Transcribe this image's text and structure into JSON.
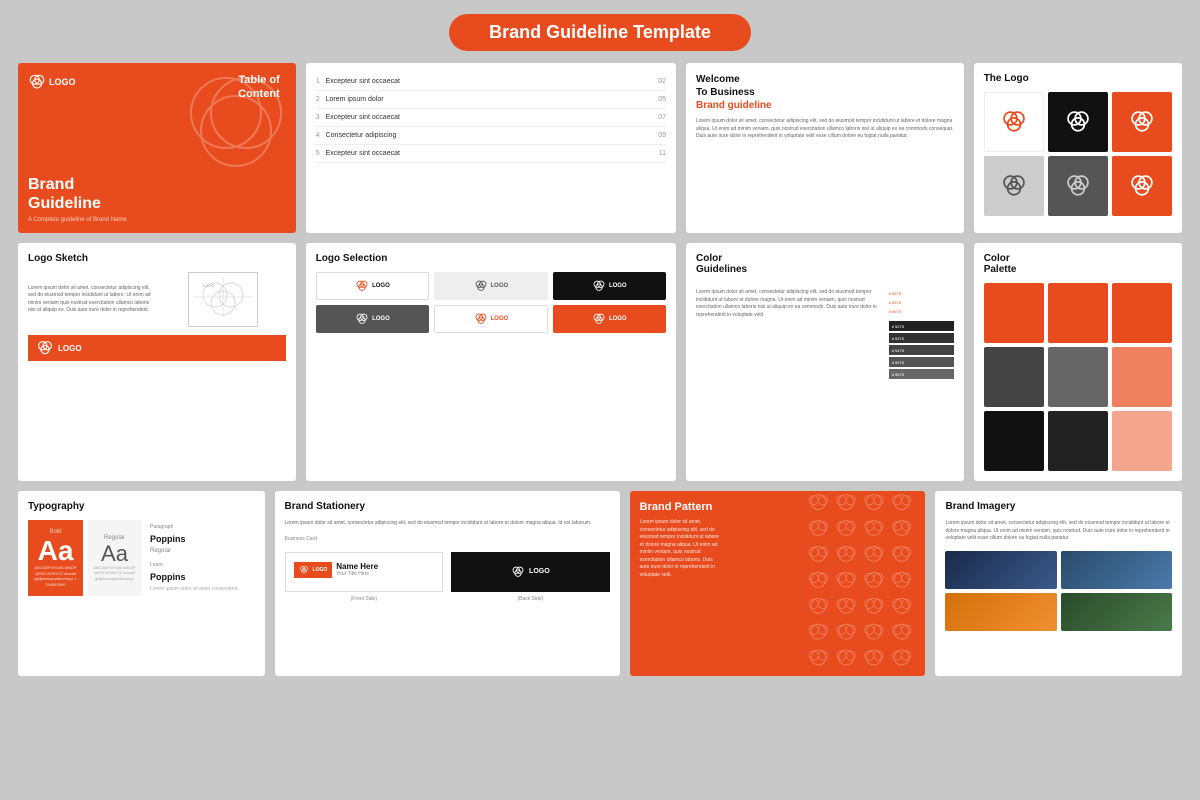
{
  "header": {
    "title": "Brand Guideline Template",
    "badge_bg": "#e84c1e"
  },
  "row1": {
    "panel_cover": {
      "logo_text": "LOGO",
      "table_of_content": "Table of\nContent",
      "title": "Brand\nGuideline",
      "subtitle": "A Complete guideline of Brand Name"
    },
    "panel_toc": {
      "items": [
        {
          "num": "1",
          "label": "Excepteur sint occaecat",
          "page": "02"
        },
        {
          "num": "2",
          "label": "Lorem ipsum dolor",
          "page": "05"
        },
        {
          "num": "3",
          "label": "Excepteur sint occaecat",
          "page": "07"
        },
        {
          "num": "4",
          "label": "Consectetur adipiscing",
          "page": "09"
        },
        {
          "num": "5",
          "label": "Excepteur sint occaecat",
          "page": "11"
        }
      ]
    },
    "panel_welcome": {
      "title_black": "Welcome\nTo Business",
      "title_red": "Brand guideline",
      "body": "Lorem ipsum dolor sit amet, consectetur adipiscing elit, sed do eiusmod tempor incididunt ut labore et dolore magna aliqua. Ut enim ad minim veniam, quis nostrud exercitation ullamco laboris nisi ut aliquip ex ea commodo consequat. Duis aute irure dolor in reprehenderit in voluptate velit esse cillum dolore eu fugiat nulla pariatur."
    },
    "panel_the_logo": {
      "title": "The Logo",
      "variants": [
        {
          "bg": "#fff",
          "border": true,
          "color": "#e84c1e"
        },
        {
          "bg": "#111",
          "border": false,
          "color": "#fff"
        },
        {
          "bg": "#e84c1e",
          "border": false,
          "color": "#fff"
        },
        {
          "bg": "#ccc",
          "border": false,
          "color": "#555"
        },
        {
          "bg": "#555",
          "border": false,
          "color": "#ccc"
        },
        {
          "bg": "#e84c1e",
          "border": false,
          "color": "#fff"
        }
      ]
    }
  },
  "row2": {
    "panel_logo_sketch": {
      "title": "Logo Sketch",
      "body": "Lorem ipsum dolor sit amet, consectetur adipiscing elit, sed do eiusmod tempor incididunt ut labore. Ut enim ad minim veniam quis nostrud exercitation ullamco laboris nisi ut aliquip ex. Duis aute irure dolor in reprehenderit."
    },
    "panel_logo_selection": {
      "title": "Logo Selection"
    },
    "panel_color_guidelines": {
      "title": "Color\nGuidelines",
      "body": "Lorem ipsum dolor sit amet, consectetur adipiscing elit, sed do eiusmod tempor incididunt ut labore et dolore magna. Ut enim ad minim veniam, quis nostrud exercitation ullamco laboris nisi ut aliquip ex ea commodo. Duis aute irure dolor in reprehenderit in voluptate velit.",
      "swatches_red": [
        {
          "label": "# 5275",
          "color": "#e84c1e"
        },
        {
          "label": "# 5375",
          "color": "#e84c1e"
        },
        {
          "label": "# 6575",
          "color": "#e84c1e"
        }
      ],
      "swatches_dark": [
        {
          "label": "# 5275"
        },
        {
          "label": "# 5375"
        },
        {
          "label": "# 5475"
        },
        {
          "label": "# 5575"
        },
        {
          "label": "# 5675"
        }
      ]
    },
    "panel_color_palette": {
      "title": "Color\nPalette",
      "swatches": [
        "#e84c1e",
        "#e84c1e",
        "#e84c1e",
        "#333333",
        "#555555",
        "#e84c1e",
        "#111111",
        "#111111",
        "#e84c1e"
      ]
    }
  },
  "row3": {
    "panel_typography": {
      "title": "Typography",
      "font_name": "Poppins",
      "font_name2": "Poppins",
      "font_style": "Regular",
      "font_style2": "Learn",
      "letters": "ABCDEFGHIJKLMNOPQRSTUVWXYZ abcdefghijklmnopqrstuvwxyz 1234567890 !@#$%^&*()_+"
    },
    "panel_brand_stationery": {
      "title": "Brand Stationery",
      "body": "Lorem ipsum dolor sit amet, consectetur adipiscing elit, sed do eiusmod tempor incididunt ut labore et dolore magna aliqua. Id est laborum.",
      "front_label": "(Front Side)",
      "back_label": "(Back Side)",
      "name": "Name Here",
      "name_sub": "Your Title Here"
    },
    "panel_brand_pattern": {
      "title": "Brand Pattern",
      "body": "Lorem ipsum dolor sit amet, consectetur adipiscing elit, sed do eiusmod tempor incididunt ut labore et dolore magna aliqua. Ut enim ad minim veniam, quis nostrud exercitation ullamco laboris. Duis aute irure dolor in reprehenderit in voluptate velit."
    },
    "panel_brand_imagery": {
      "title": "Brand Imagery",
      "body": "Lorem ipsum dolor sit amet, consectetur adipiscing elit, sed do eiusmod tempor incididunt ut labore et dolore magna aliqua. Ut enim ad minim veniam, quis nostrud. Duis aute irure dolor in reprehenderit in voluptate velit esse cillum dolore eu fugiat nulla pariatur."
    }
  }
}
